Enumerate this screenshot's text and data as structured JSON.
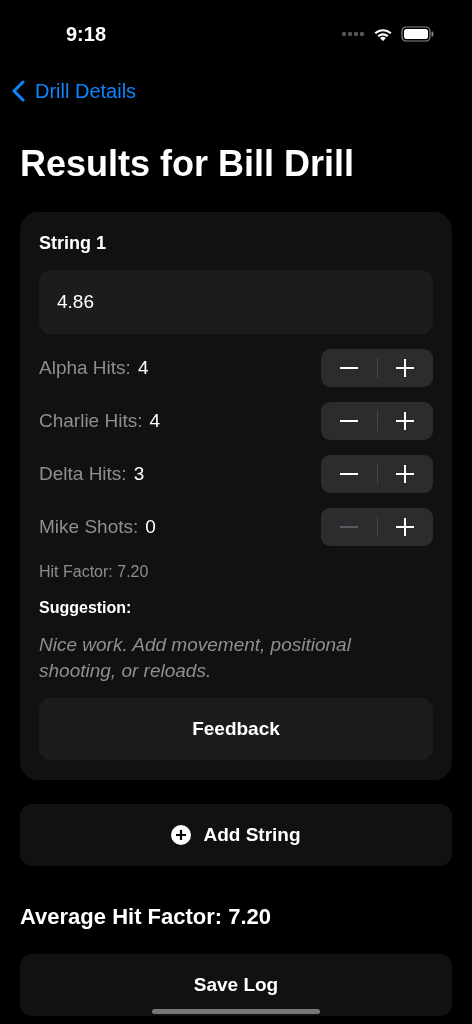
{
  "status_bar": {
    "time": "9:18"
  },
  "nav": {
    "back_label": "Drill Details"
  },
  "title": "Results for Bill Drill",
  "string_card": {
    "heading": "String 1",
    "time_value": "4.86",
    "counters": [
      {
        "label": "Alpha Hits:",
        "value": "4",
        "minus_disabled": false
      },
      {
        "label": "Charlie Hits:",
        "value": "4",
        "minus_disabled": false
      },
      {
        "label": "Delta Hits:",
        "value": "3",
        "minus_disabled": false
      },
      {
        "label": "Mike Shots:",
        "value": "0",
        "minus_disabled": true
      }
    ],
    "hit_factor": "Hit Factor: 7.20",
    "suggestion_heading": "Suggestion:",
    "suggestion": "Nice work. Add movement, positional shooting, or reloads.",
    "feedback_button": "Feedback"
  },
  "add_string_button": "Add String",
  "average": "Average Hit Factor: 7.20",
  "save_button": "Save Log"
}
